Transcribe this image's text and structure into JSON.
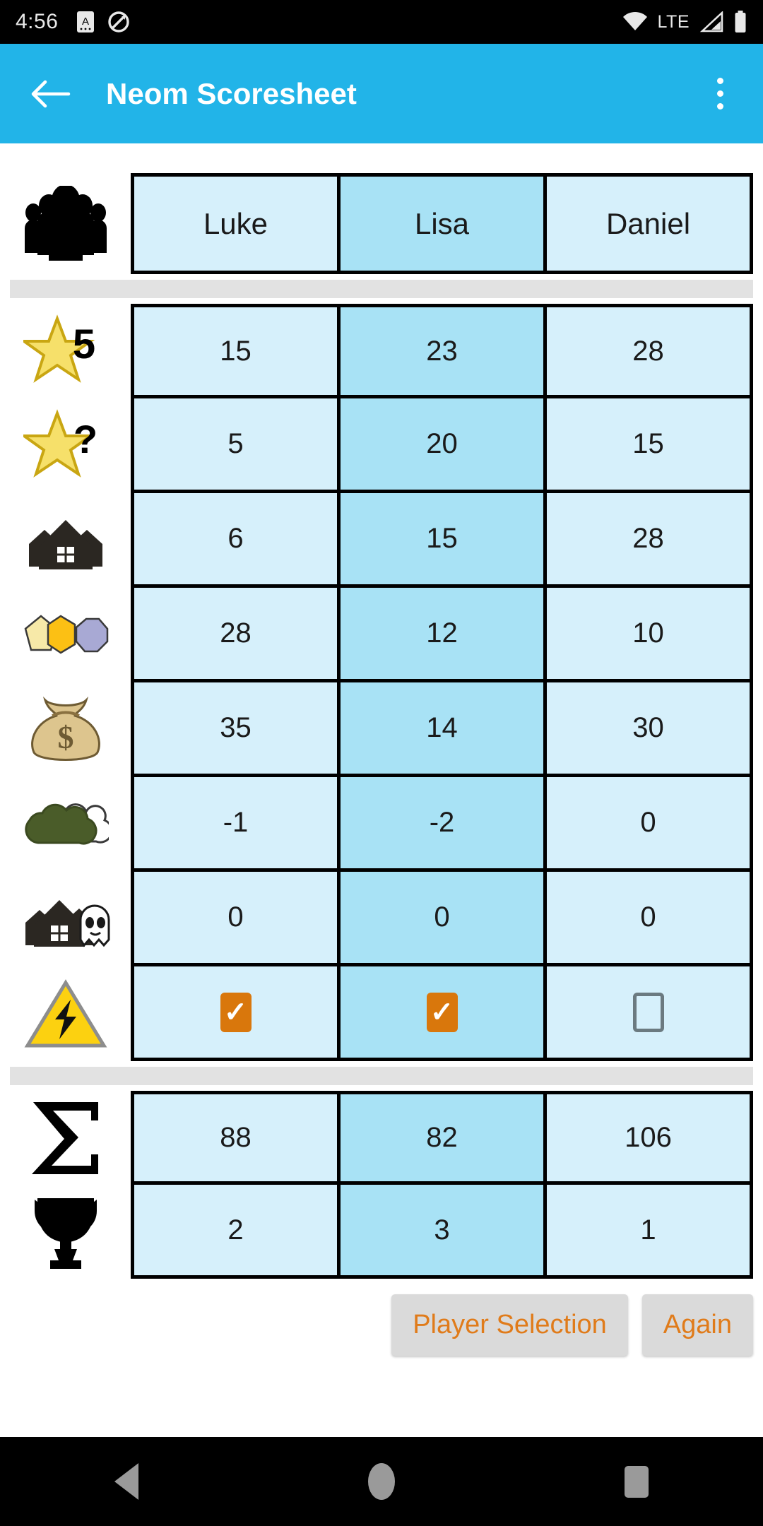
{
  "status_bar": {
    "clock": "4:56",
    "left_icons": [
      "alphabet-mode-icon",
      "no-rotation-icon"
    ],
    "network_label": "LTE",
    "right_icons": [
      "wifi-icon",
      "signal-icon",
      "battery-icon"
    ]
  },
  "app_bar": {
    "back_label": "Back",
    "title": "Neom Scoresheet",
    "overflow_label": "More options"
  },
  "scoresheet": {
    "players_icon": "group-of-people-icon",
    "players": [
      {
        "name": "Luke",
        "highlight": false
      },
      {
        "name": "Lisa",
        "highlight": true
      },
      {
        "name": "Daniel",
        "highlight": false
      }
    ],
    "score_rows": [
      {
        "icon": "star-five-icon",
        "values": [
          "15",
          "23",
          "28"
        ],
        "type": "number"
      },
      {
        "icon": "star-question-icon",
        "values": [
          "5",
          "20",
          "15"
        ],
        "type": "number"
      },
      {
        "icon": "house-icon",
        "values": [
          "6",
          "15",
          "28"
        ],
        "type": "number"
      },
      {
        "icon": "polygon-tiles-icon",
        "values": [
          "28",
          "12",
          "10"
        ],
        "type": "number"
      },
      {
        "icon": "money-bag-icon",
        "values": [
          "35",
          "14",
          "30"
        ],
        "type": "number"
      },
      {
        "icon": "green-bushes-icon",
        "values": [
          "-1",
          "-2",
          "0"
        ],
        "type": "number"
      },
      {
        "icon": "haunted-house-icon",
        "values": [
          "0",
          "0",
          "0"
        ],
        "type": "number"
      },
      {
        "icon": "hazard-lightning-icon",
        "values": [
          "checked",
          "checked",
          "unchecked"
        ],
        "type": "checkbox"
      }
    ],
    "total_rows": [
      {
        "icon": "sigma-sum-icon",
        "values": [
          "88",
          "82",
          "106"
        ],
        "type": "number"
      },
      {
        "icon": "trophy-icon",
        "values": [
          "2",
          "3",
          "1"
        ],
        "type": "number"
      }
    ]
  },
  "actions": {
    "player_selection_label": "Player Selection",
    "again_label": "Again"
  },
  "nav_bar": {
    "back": "nav-back-icon",
    "home": "nav-home-icon",
    "recents": "nav-recents-icon"
  },
  "colors": {
    "accent_blue": "#22b4e8",
    "cell_light": "#d6f0fb",
    "cell_highlight": "#a8e2f5",
    "checkbox_orange": "#d9770c",
    "button_text_orange": "#e07b1a"
  }
}
